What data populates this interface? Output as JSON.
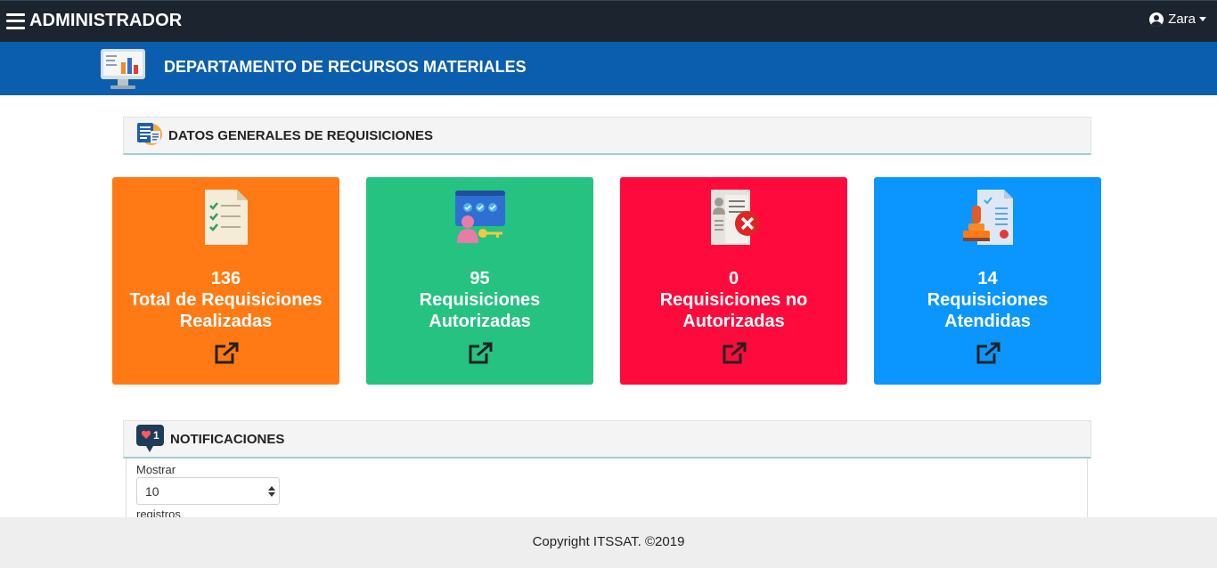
{
  "topbar": {
    "brand": "ADMINISTRADOR",
    "user_name": "Zara"
  },
  "department": {
    "title": "DEPARTAMENTO DE RECURSOS MATERIALES"
  },
  "general_panel": {
    "title": "DATOS GENERALES DE REQUISICIONES"
  },
  "cards": [
    {
      "count": "136",
      "label_line1": "Total de Requisiciones",
      "label_line2": "Realizadas",
      "color": "#ff7a14"
    },
    {
      "count": "95",
      "label_line1": "Requisiciones",
      "label_line2": "Autorizadas",
      "color": "#26c281"
    },
    {
      "count": "0",
      "label_line1": "Requisiciones no",
      "label_line2": "Autorizadas",
      "color": "#ff0a3c"
    },
    {
      "count": "14",
      "label_line1": "Requisiciones",
      "label_line2": "Atendidas",
      "color": "#0b96ff"
    }
  ],
  "notifications": {
    "title": "NOTIFICACIONES",
    "badge_count": "1",
    "length_label": "Mostrar",
    "length_value": "10",
    "length_suffix": "registros"
  },
  "footer": {
    "text": "Copyright ITSSAT. ©2019"
  },
  "icons": {
    "menu": "hamburger-icon",
    "user": "user-circle-icon",
    "dept": "monitor-chart-icon",
    "panel": "clipboard-list-icon",
    "notif": "heart-bubble-icon",
    "card1": "checklist-document-icon",
    "card2": "approval-key-icon",
    "card3": "rejected-document-icon",
    "card4": "stamp-document-icon",
    "link": "external-link-icon"
  }
}
